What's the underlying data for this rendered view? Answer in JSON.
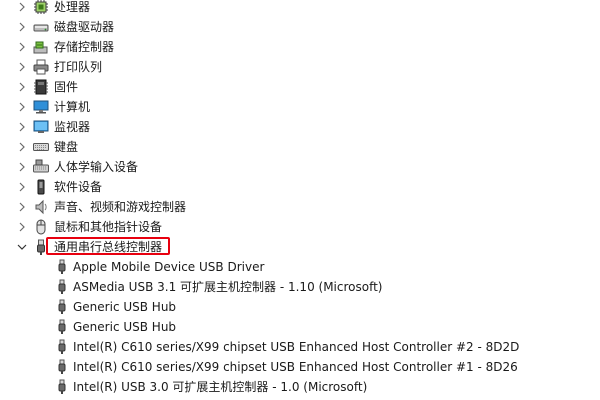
{
  "categories": [
    {
      "label": "处理器",
      "icon": "processor-icon"
    },
    {
      "label": "磁盘驱动器",
      "icon": "disk-drive-icon"
    },
    {
      "label": "存储控制器",
      "icon": "storage-controller-icon"
    },
    {
      "label": "打印队列",
      "icon": "printer-icon"
    },
    {
      "label": "固件",
      "icon": "firmware-icon"
    },
    {
      "label": "计算机",
      "icon": "computer-icon"
    },
    {
      "label": "监视器",
      "icon": "monitor-icon"
    },
    {
      "label": "键盘",
      "icon": "keyboard-icon"
    },
    {
      "label": "人体学输入设备",
      "icon": "hid-icon"
    },
    {
      "label": "软件设备",
      "icon": "software-device-icon"
    },
    {
      "label": "声音、视频和游戏控制器",
      "icon": "speaker-icon"
    },
    {
      "label": "鼠标和其他指针设备",
      "icon": "mouse-icon"
    }
  ],
  "expanded": {
    "label": "通用串行总线控制器",
    "icon": "usb-icon",
    "children": [
      {
        "label": "Apple Mobile Device USB Driver"
      },
      {
        "label": "ASMedia USB 3.1 可扩展主机控制器 - 1.10 (Microsoft)"
      },
      {
        "label": "Generic USB Hub"
      },
      {
        "label": "Generic USB Hub"
      },
      {
        "label": "Intel(R) C610 series/X99 chipset USB Enhanced Host Controller #2 - 8D2D"
      },
      {
        "label": "Intel(R) C610 series/X99 chipset USB Enhanced Host Controller #1 - 8D26"
      },
      {
        "label": "Intel(R) USB 3.0 可扩展主机控制器 - 1.0 (Microsoft)"
      }
    ]
  },
  "colors": {
    "highlight_border": "#e8000f",
    "chevron": "#6b6b6b"
  }
}
